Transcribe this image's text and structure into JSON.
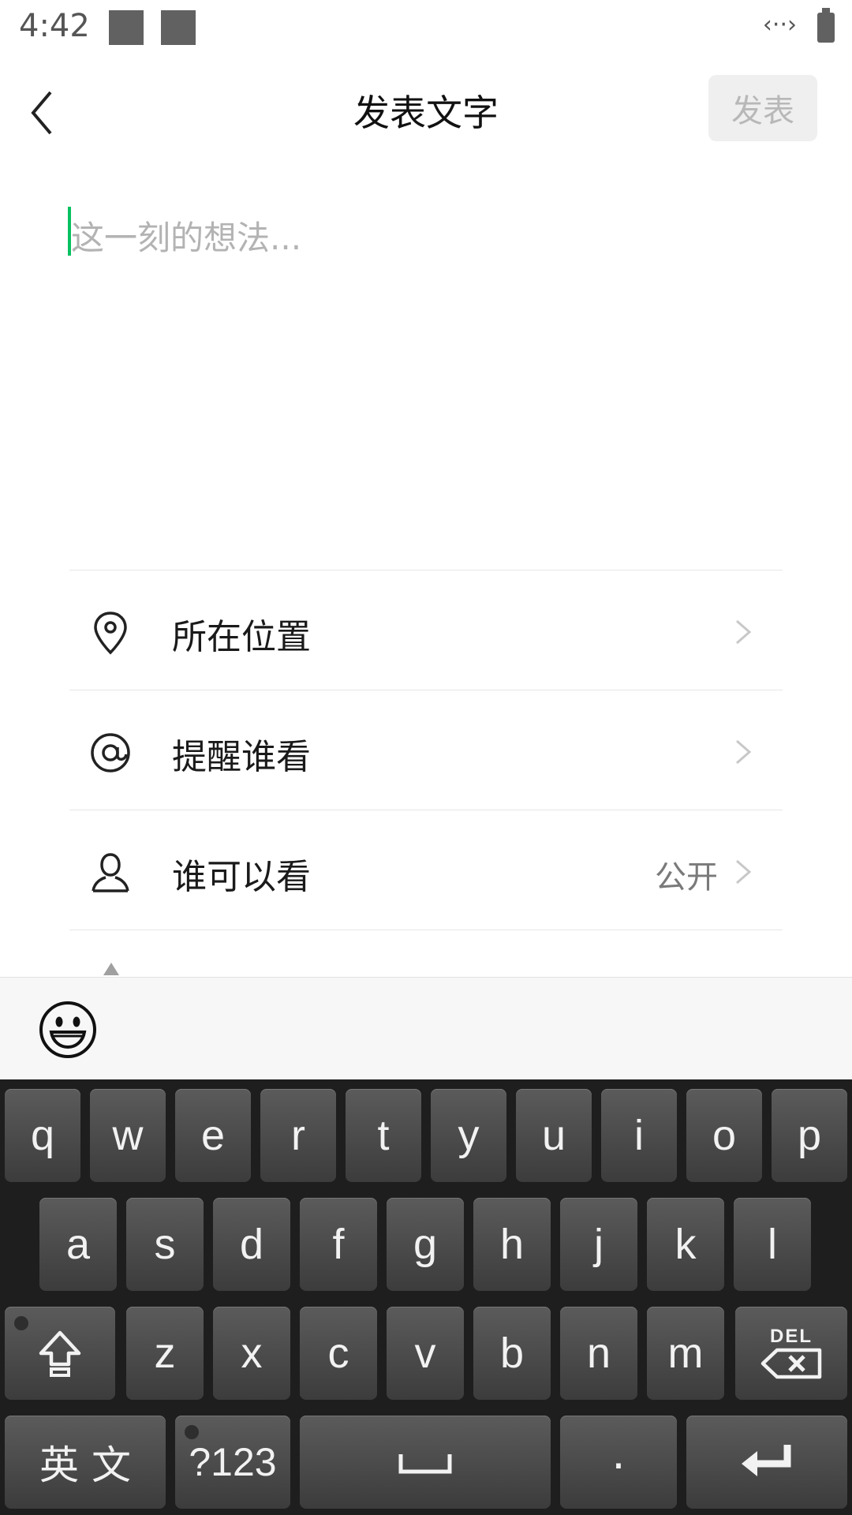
{
  "status_bar": {
    "time": "4:42"
  },
  "header": {
    "title": "发表文字",
    "publish_label": "发表"
  },
  "composer": {
    "placeholder": "这一刻的想法..."
  },
  "options": [
    {
      "label": "所在位置",
      "value": "",
      "icon": "location-pin-icon"
    },
    {
      "label": "提醒谁看",
      "value": "",
      "icon": "at-icon"
    },
    {
      "label": "谁可以看",
      "value": "公开",
      "icon": "person-icon"
    }
  ],
  "keyboard": {
    "row1": [
      "q",
      "w",
      "e",
      "r",
      "t",
      "y",
      "u",
      "i",
      "o",
      "p"
    ],
    "row2": [
      "a",
      "s",
      "d",
      "f",
      "g",
      "h",
      "j",
      "k",
      "l"
    ],
    "row3": [
      "z",
      "x",
      "c",
      "v",
      "b",
      "n",
      "m"
    ],
    "lang_label": "英 文",
    "symbols_label": "?123",
    "period_label": "·",
    "delete_label": "DEL"
  },
  "colors": {
    "accent": "#07c160",
    "keyboard_bg": "#1e1e1e",
    "key_bg": "#4a4a4a"
  }
}
